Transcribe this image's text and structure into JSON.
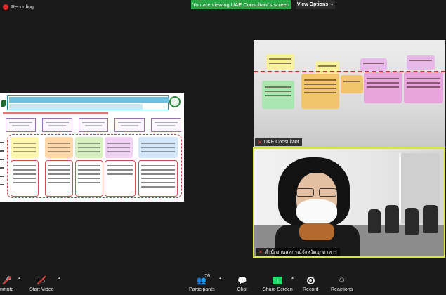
{
  "top": {
    "recording_label": "Recording",
    "banner_text": "You are viewing UAE Consultant's screen",
    "view_options_label": "View Options"
  },
  "participants": {
    "tile_top_name": "UAE Consultant",
    "tile_bottom_name": "สำนักงานสหกรณ์จังหวัดมุกดาหาร"
  },
  "toolbar": {
    "unmute_label": "nmute",
    "start_video_label": "Start Video",
    "participants_label": "Participants",
    "participants_count": "76",
    "chat_label": "Chat",
    "share_screen_label": "Share Screen",
    "record_label": "Record",
    "reactions_label": "Reactions"
  },
  "colors": {
    "banner": "#28a745",
    "share_screen": "#23d96b",
    "active_speaker_border": "#d8e83a"
  }
}
